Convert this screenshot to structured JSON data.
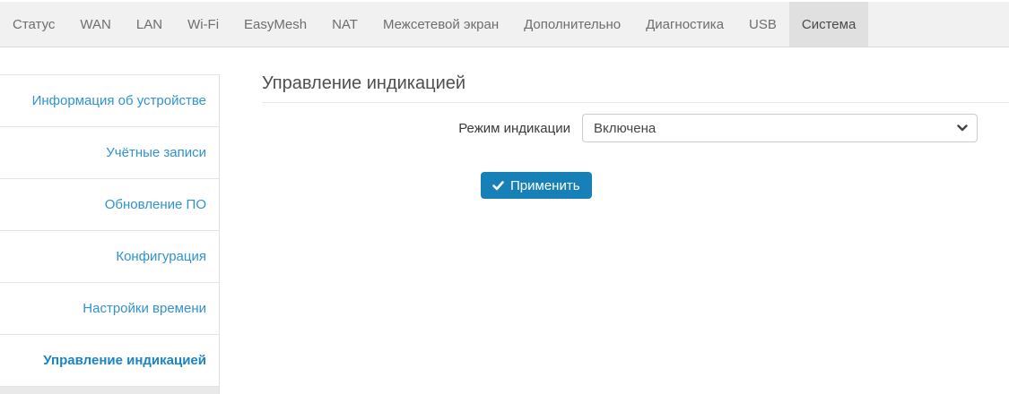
{
  "nav": {
    "items": [
      {
        "label": "Статус",
        "active": false
      },
      {
        "label": "WAN",
        "active": false
      },
      {
        "label": "LAN",
        "active": false
      },
      {
        "label": "Wi-Fi",
        "active": false
      },
      {
        "label": "EasyMesh",
        "active": false
      },
      {
        "label": "NAT",
        "active": false
      },
      {
        "label": "Межсетевой экран",
        "active": false
      },
      {
        "label": "Дополнительно",
        "active": false
      },
      {
        "label": "Диагностика",
        "active": false
      },
      {
        "label": "USB",
        "active": false
      },
      {
        "label": "Система",
        "active": true
      }
    ]
  },
  "sidebar": {
    "items": [
      {
        "label": "Информация об устройстве",
        "active": false
      },
      {
        "label": "Учётные записи",
        "active": false
      },
      {
        "label": "Обновление ПО",
        "active": false
      },
      {
        "label": "Конфигурация",
        "active": false
      },
      {
        "label": "Настройки времени",
        "active": false
      },
      {
        "label": "Управление индикацией",
        "active": true
      }
    ]
  },
  "main": {
    "title": "Управление индикацией",
    "form": {
      "mode_label": "Режим индикации",
      "mode_value": "Включена"
    },
    "apply_button": {
      "label": "Применить",
      "icon": "check-icon"
    }
  },
  "colors": {
    "link_blue": "#2e93cf",
    "active_link_blue": "#1a84c4",
    "button_blue": "#1780b6",
    "nav_bg": "#f1f1f1",
    "nav_active_bg": "#e0e0e0"
  }
}
